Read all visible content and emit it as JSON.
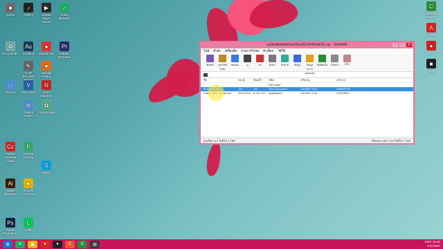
{
  "desktop": {
    "left_icons": [
      {
        "label": "Game",
        "color": "#6b6b6b",
        "glyph": "■"
      },
      {
        "label": "AIMP3",
        "color": "#222",
        "glyph": "♪"
      },
      {
        "label": "Media Player Classic",
        "color": "#2a2a2a",
        "glyph": "▶"
      },
      {
        "label": "IObit Malware",
        "color": "#2a6",
        "glyph": "✓"
      },
      {
        "label": "Recycle Bin",
        "color": "#7aa",
        "glyph": "♻"
      },
      {
        "label": "Audition",
        "color": "#1b3b5a",
        "glyph": "Au"
      },
      {
        "label": "Miracle FM",
        "color": "#d33",
        "glyph": "●"
      },
      {
        "label": "Adobe Premiere",
        "color": "#2b2b6b",
        "glyph": "Pr"
      },
      {
        "label": "CLIP STUDIO PAINT",
        "color": "#666",
        "glyph": "✎"
      },
      {
        "label": "Mozilla Firefox",
        "color": "#e66a12",
        "glyph": "●"
      },
      {
        "label": "This PC",
        "color": "#4a8fd0",
        "glyph": "▭"
      },
      {
        "label": "Visio 2013",
        "color": "#2b5fa8",
        "glyph": "V"
      },
      {
        "label": "Nero Express",
        "color": "#c22",
        "glyph": "N"
      },
      {
        "label": "Control Panel",
        "color": "#4a8fd0",
        "glyph": "⚙"
      },
      {
        "label": "PhotoScape",
        "color": "#5a8",
        "glyph": "✿"
      },
      {
        "label": "Adobe Creative Cloud",
        "color": "#d22",
        "glyph": "Cc"
      },
      {
        "label": "Format Factory",
        "color": "#3a6",
        "glyph": "F"
      },
      {
        "label": "Skype",
        "color": "#0aa0e0",
        "glyph": "S"
      },
      {
        "label": "Adobe Illustrator",
        "color": "#3b1e00",
        "glyph": "Ai"
      },
      {
        "label": "Google Chrome",
        "color": "#e4b400",
        "glyph": "●"
      },
      {
        "label": "Adobe Photoshop",
        "color": "#0c2440",
        "glyph": "Ps"
      },
      {
        "label": "LINE",
        "color": "#06c755",
        "glyph": "L"
      }
    ],
    "right_icons": [
      {
        "label": "Camtasia Studio",
        "color": "#2a8f3a",
        "glyph": "C"
      },
      {
        "label": "Adobe",
        "color": "#d22",
        "glyph": "A"
      },
      {
        "label": "App",
        "color": "#c22",
        "glyph": "●"
      },
      {
        "label": "App",
        "color": "#222",
        "glyph": "■"
      }
    ]
  },
  "window": {
    "title": "ad3b48bdbd639ef3fca20149459eb7f1.rar - WinRAR",
    "menu": [
      "ไฟล์",
      "คำสั่ง",
      "เครื่องมือ",
      "รายการโปรด",
      "ตัวเลือก",
      "วิธีใช้"
    ],
    "toolbar": [
      {
        "label": "เพิ่มเข้า",
        "color": "#7a55b8"
      },
      {
        "label": "แยกไฟล์ไปยัง",
        "color": "#b98a2a"
      },
      {
        "label": "ทดสอบ",
        "color": "#3a7ad8"
      },
      {
        "label": "ดู",
        "color": "#444"
      },
      {
        "label": "ลบ",
        "color": "#c33"
      },
      {
        "label": "ค้นหา",
        "color": "#7a7a7a"
      },
      {
        "label": "ตัวช่วย",
        "color": "#3a9"
      },
      {
        "label": "ข้อมูล",
        "color": "#3a6ad8"
      },
      {
        "label": "ข้อมูลความปลอดภัย",
        "color": "#e0a020"
      },
      {
        "label": "ข้อคิดเห็น",
        "color": "#2a8a3a"
      },
      {
        "label": "ป้องกัน",
        "color": "#888"
      },
      {
        "label": "SFX",
        "color": "#b88"
      }
    ],
    "columns": [
      "ชื่อ",
      "ขนาด",
      "บีบแล้ว",
      "ชนิด",
      "ปรับปรุง",
      "CRC32"
    ],
    "rows": [
      {
        "name": "..",
        "size": "",
        "packed": "",
        "type": "File folder",
        "modified": "",
        "crc": "",
        "selected": false
      },
      {
        "name": "คำแนะนำ.txt",
        "size": "112",
        "packed": "112",
        "type": "Text Document",
        "modified": "1/8/2557 0:47",
        "crc": "ADBDFF0F",
        "selected": true
      },
      {
        "name": "Setup_Plus_Serial.exe",
        "size": "8,822,592",
        "packed": "8,947,327",
        "type": "Application",
        "modified": "1/8/2557 0:48",
        "crc": "C5930B01",
        "selected": false
      }
    ],
    "status_left": "ถูกเลือก 112 ไบต์ใน 1 ไฟล์",
    "status_right": "ทั้งหมด 8,822,704 ไบต์ใน 2 ไฟล์"
  },
  "taskbar": {
    "items": [
      {
        "color": "#1e6fd0",
        "glyph": "⊞"
      },
      {
        "color": "#2a6",
        "glyph": "e"
      },
      {
        "color": "#e4b400",
        "glyph": "▣"
      },
      {
        "color": "#d22",
        "glyph": "●"
      },
      {
        "color": "#222",
        "glyph": "●"
      },
      {
        "color": "#e4572e",
        "glyph": "C"
      },
      {
        "color": "#2a8f3a",
        "glyph": "C"
      },
      {
        "color": "#3a3a3a",
        "glyph": "▤"
      }
    ],
    "lang": "ENG",
    "time": "16:20",
    "date": "7/11/2557"
  }
}
